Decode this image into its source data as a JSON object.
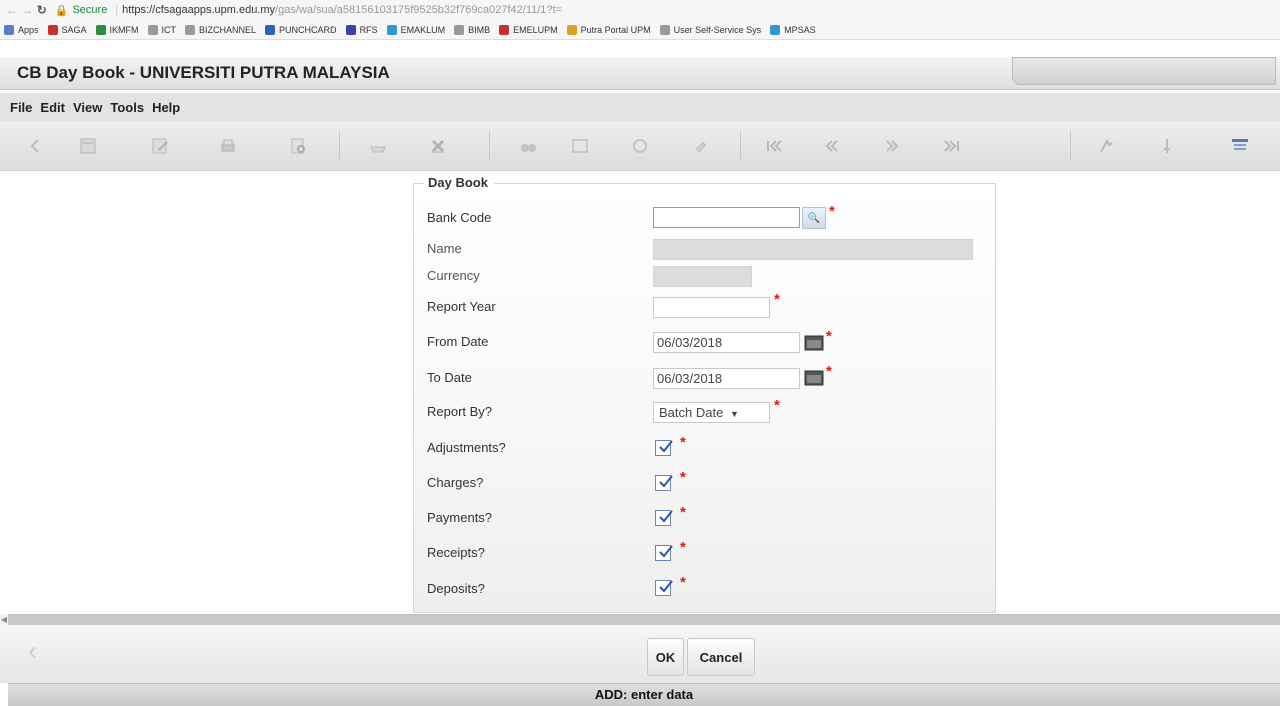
{
  "browser": {
    "secure_label": "Secure",
    "url_host": "https://cfsagaapps.upm.edu.my",
    "url_path": "/gas/wa/sua/a58156103175f9525b32f769ca027f42/11/1?t="
  },
  "bookmarks": [
    {
      "label": "Apps",
      "color": "#5f7cc2"
    },
    {
      "label": "SAGA",
      "color": "#c9302c"
    },
    {
      "label": "IKMFM",
      "color": "#2f8c3a"
    },
    {
      "label": "ICT",
      "color": "#9a9a9a"
    },
    {
      "label": "BIZCHANNEL",
      "color": "#9a9a9a"
    },
    {
      "label": "PUNCHCARD",
      "color": "#2a62c7"
    },
    {
      "label": "RFS",
      "color": "#3a43a8"
    },
    {
      "label": "EMAKLUM",
      "color": "#2b9ad6"
    },
    {
      "label": "BIMB",
      "color": "#9a9a9a"
    },
    {
      "label": "EMELUPM",
      "color": "#c2332f"
    },
    {
      "label": "Putra Portal UPM",
      "color": "#e0a020"
    },
    {
      "label": "User Self-Service Sys",
      "color": "#9a9a9a"
    },
    {
      "label": "MPSAS",
      "color": "#2b9ad6"
    }
  ],
  "app": {
    "title": "CB Day Book - UNIVERSITI PUTRA MALAYSIA"
  },
  "menu": [
    "File",
    "Edit",
    "View",
    "Tools",
    "Help"
  ],
  "toolbar_icons": [
    "back-icon",
    "notebook-icon",
    "edit-note-icon",
    "print-icon",
    "print-preview-icon",
    "save-icon",
    "delete-icon",
    "find-icon",
    "list-icon",
    "info-icon",
    "attach-icon",
    "first-record-icon",
    "previous-record-icon",
    "next-record-icon",
    "last-record-icon",
    "run-icon",
    "pin-icon",
    "layout-icon"
  ],
  "form": {
    "legend": "Day Book",
    "fields": {
      "bank_code": {
        "label": "Bank Code",
        "value": ""
      },
      "name": {
        "label": "Name",
        "value": ""
      },
      "currency": {
        "label": "Currency",
        "value": ""
      },
      "report_year": {
        "label": "Report Year",
        "value": ""
      },
      "from_date": {
        "label": "From Date",
        "value": "06/03/2018"
      },
      "to_date": {
        "label": "To Date",
        "value": "06/03/2018"
      },
      "report_by": {
        "label": "Report By?",
        "value": "Batch Date"
      },
      "adjustments": {
        "label": "Adjustments?",
        "checked": true
      },
      "charges": {
        "label": "Charges?",
        "checked": true
      },
      "payments": {
        "label": "Payments?",
        "checked": true
      },
      "receipts": {
        "label": "Receipts?",
        "checked": true
      },
      "deposits": {
        "label": "Deposits?",
        "checked": true
      }
    },
    "required_mark": "*"
  },
  "buttons": {
    "ok": "OK",
    "cancel": "Cancel"
  },
  "status": "ADD: enter data"
}
